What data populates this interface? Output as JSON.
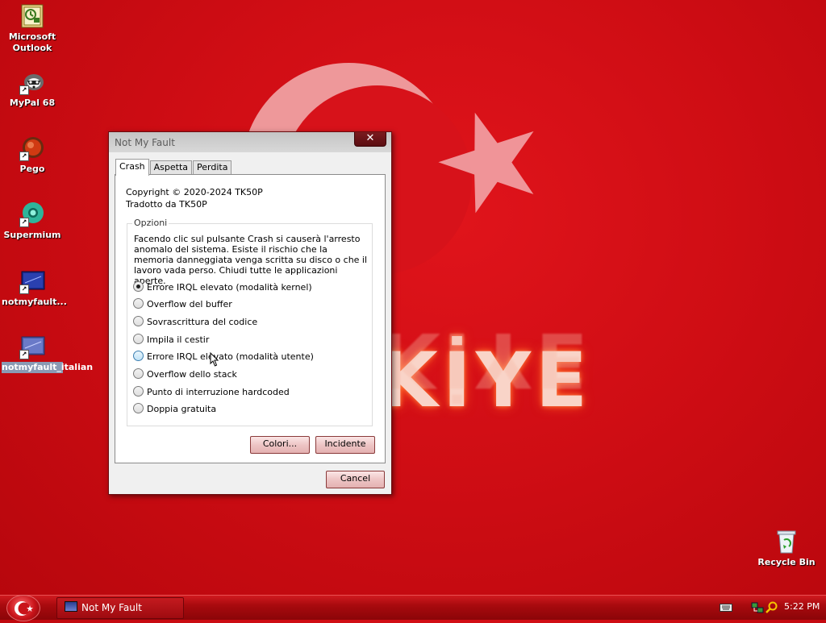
{
  "desktop": {
    "icons": [
      {
        "label": "Microsoft Outlook",
        "icon": "outlook-icon"
      },
      {
        "label": "MyPal 68",
        "icon": "mypal-icon"
      },
      {
        "label": "Pego",
        "icon": "pego-icon"
      },
      {
        "label": "Supermium",
        "icon": "supermium-icon"
      },
      {
        "label": "notmyfault...",
        "icon": "notmyfault-icon"
      },
      {
        "label": "notmyfault_italian",
        "icon": "notmyfault-icon"
      }
    ],
    "recycle_bin": {
      "label": "Recycle Bin",
      "icon": "recycle-bin-icon"
    },
    "wallpaper_text": "KİYE"
  },
  "dialog": {
    "title": "Not My Fault",
    "close_glyph": "✕",
    "tabs": [
      "Crash",
      "Aspetta",
      "Perdita"
    ],
    "active_tab": "Crash",
    "copyright": "Copyright © 2020-2024 TK50P",
    "translated_by": "Tradotto da TK50P",
    "group_title": "Opzioni",
    "description": "Facendo clic sul pulsante Crash si causerà l'arresto anomalo del sistema. Esiste il rischio che la memoria danneggiata venga scritta su disco o che il lavoro vada perso. Chiudi tutte le applicazioni aperte.",
    "options": [
      {
        "label": "Errore IRQL elevato (modalità kernel)",
        "checked": true
      },
      {
        "label": "Overflow del buffer",
        "checked": false
      },
      {
        "label": "Sovrascrittura del codice",
        "checked": false
      },
      {
        "label": "Impila il cestir",
        "checked": false
      },
      {
        "label": "Errore IRQL elevato (modalità utente)",
        "checked": false,
        "hover": true
      },
      {
        "label": "Overflow dello stack",
        "checked": false
      },
      {
        "label": "Punto di interruzione hardcoded",
        "checked": false
      },
      {
        "label": "Doppia gratuita",
        "checked": false
      }
    ],
    "colors_button": "Colori...",
    "crash_button": "Incidente",
    "cancel_button": "Cancel"
  },
  "taskbar": {
    "task_label": "Not My Fault",
    "clock": "5:22 PM",
    "tray_icons": [
      "keyboard-icon",
      "network-icon",
      "search-icon"
    ]
  },
  "colors": {
    "wallpaper_red": "#cf0d14",
    "taskbar_red": "#a80a0e",
    "button_pink": "#eec5c5"
  }
}
